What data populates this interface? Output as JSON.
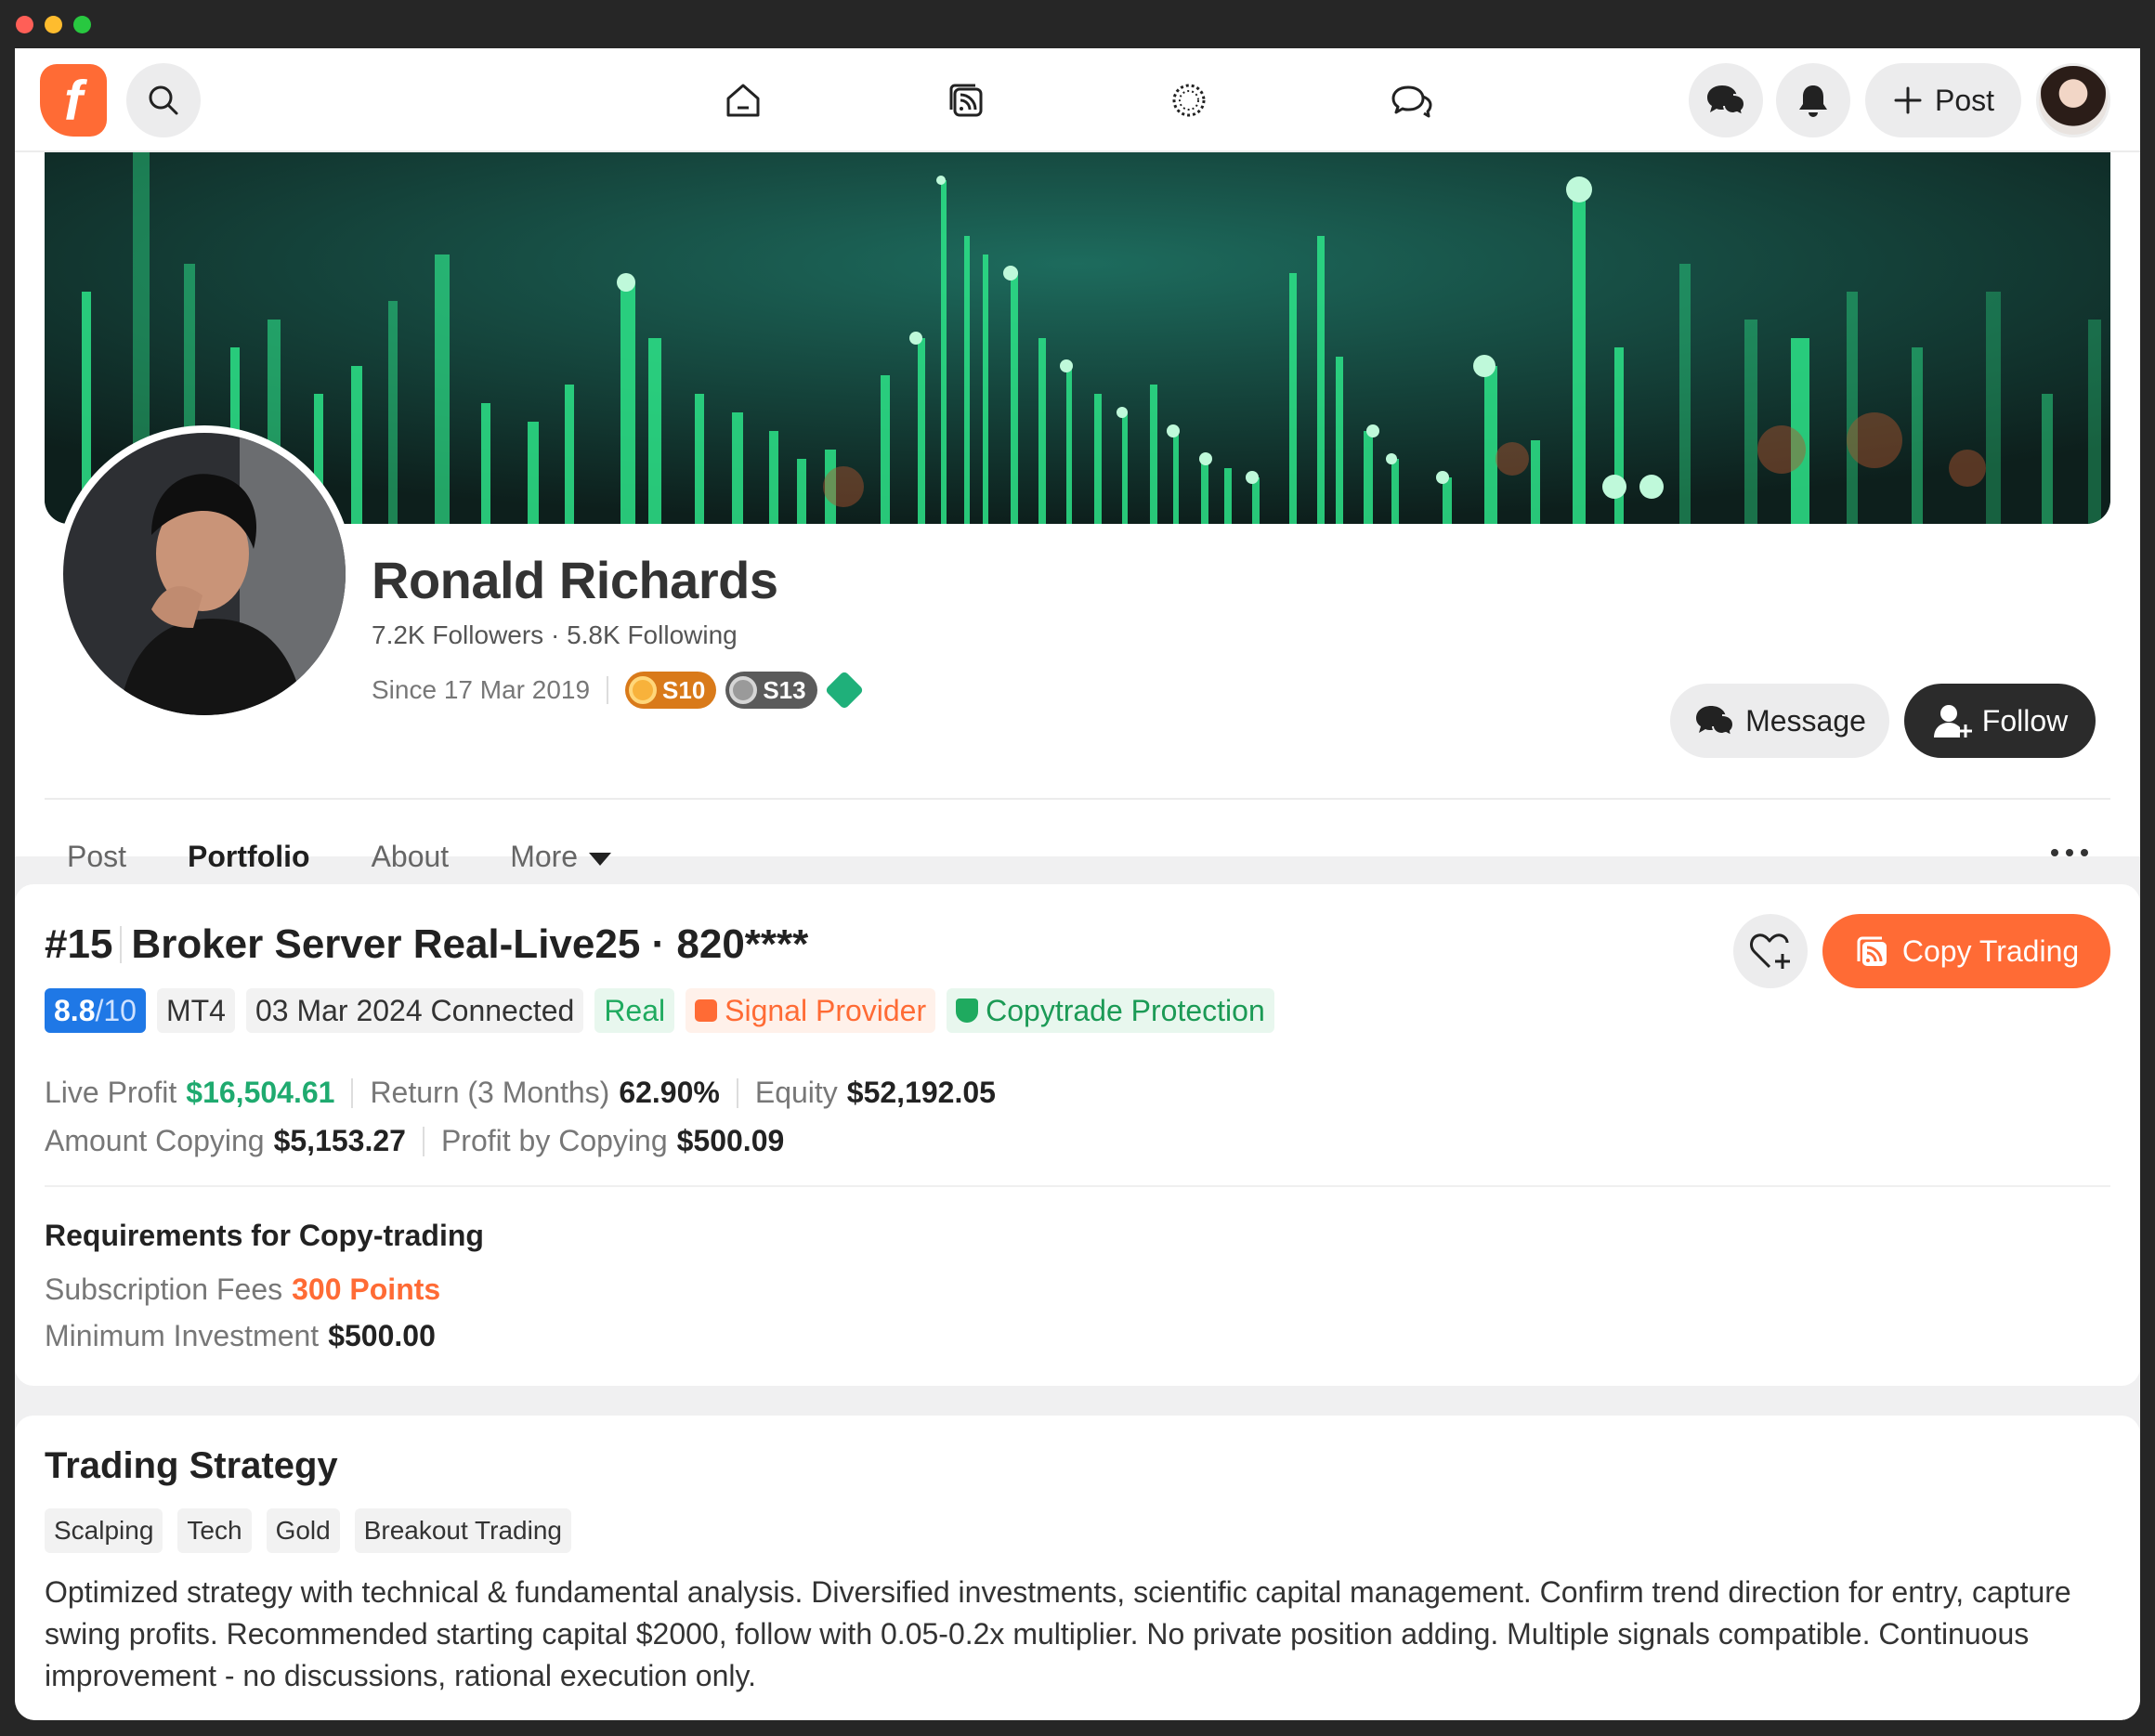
{
  "topbar": {
    "logo_text": "f",
    "post_label": "Post"
  },
  "profile": {
    "name": "Ronald Richards",
    "followers": "7.2K Followers",
    "following": "5.8K Following",
    "since": "Since 17 Mar 2019",
    "badges": [
      "S10",
      "S13"
    ],
    "message_label": "Message",
    "follow_label": "Follow"
  },
  "tabs": [
    {
      "label": "Post",
      "active": false
    },
    {
      "label": "Portfolio",
      "active": true
    },
    {
      "label": "About",
      "active": false
    },
    {
      "label": "More",
      "active": false
    }
  ],
  "account": {
    "rank": "#15",
    "server": "Broker Server Real-Live25 · 820****",
    "copy_label": "Copy Trading",
    "score": "8.8",
    "score_den": "/10",
    "platform": "MT4",
    "connected": "03 Mar 2024 Connected",
    "type": "Real",
    "signal": "Signal Provider",
    "protection": "Copytrade Protection",
    "stats_row1": [
      {
        "label": "Live Profit",
        "value": "$16,504.61",
        "color": "green"
      },
      {
        "label": "Return (3 Months)",
        "value": "62.90%",
        "color": "default"
      },
      {
        "label": "Equity",
        "value": "$52,192.05",
        "color": "default"
      }
    ],
    "stats_row2": [
      {
        "label": "Amount Copying",
        "value": "$5,153.27",
        "color": "default"
      },
      {
        "label": "Profit by Copying",
        "value": "$500.09",
        "color": "default"
      }
    ],
    "requirements_title": "Requirements for Copy-trading",
    "subscription_label": "Subscription Fees",
    "subscription_value": "300 Points",
    "min_investment_label": "Minimum Investment",
    "min_investment_value": "$500.00"
  },
  "strategy": {
    "title": "Trading Strategy",
    "tags": [
      "Scalping",
      "Tech",
      "Gold",
      "Breakout Trading"
    ],
    "description": "Optimized strategy with technical & fundamental analysis. Diversified investments, scientific capital management. Confirm trend direction for entry, capture swing profits. Recommended starting capital $2000, follow with 0.05-0.2x multiplier. No private position adding. Multiple signals compatible. Continuous improvement - no discussions, rational execution only."
  },
  "colors": {
    "accent": "#ff6b35",
    "profit_green": "#1faa6f",
    "score_blue": "#1f78e6",
    "dark_button": "#2b2b2b"
  }
}
